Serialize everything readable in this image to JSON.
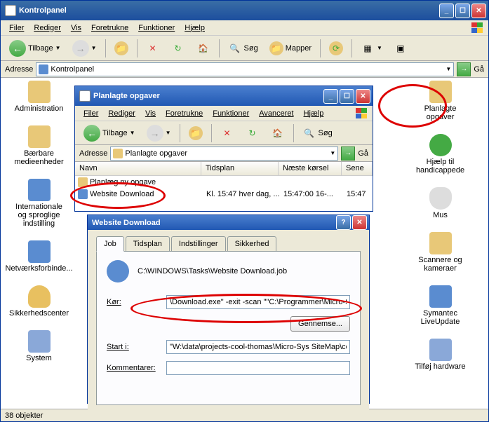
{
  "main": {
    "title": "Kontrolpanel",
    "menu": [
      "Filer",
      "Rediger",
      "Vis",
      "Foretrukne",
      "Funktioner",
      "Hjælp"
    ],
    "toolbar": {
      "back": "Tilbage",
      "search": "Søg",
      "folders": "Mapper"
    },
    "address": {
      "label": "Adresse",
      "value": "Kontrolpanel",
      "go": "Gå"
    },
    "status": "38 objekter",
    "leftIcons": [
      {
        "label": "Administration",
        "color": "#e8c878"
      },
      {
        "label": "Bærbare medieenheder",
        "color": "#e8c878"
      },
      {
        "label": "Internationale og sproglige indstilling",
        "color": "#5a8cd0"
      },
      {
        "label": "Netværksforbinde...",
        "color": "#5a8cd0"
      },
      {
        "label": "Sikkerhedscenter",
        "color": "#e8c060"
      },
      {
        "label": "System",
        "color": "#8aa8d8"
      }
    ],
    "rightIcons": [
      {
        "label": "Planlagte opgaver",
        "color": "#e8c878"
      },
      {
        "label": "Hjælp til handicappede",
        "color": "#4a4"
      },
      {
        "label": "Mus",
        "color": "#ddd"
      },
      {
        "label": "Scannere og kameraer",
        "color": "#e8c878"
      },
      {
        "label": "Symantec LiveUpdate",
        "color": "#5a8cd0"
      },
      {
        "label": "Tilføj hardware",
        "color": "#8aa8d8"
      }
    ]
  },
  "tasks": {
    "title": "Planlagte opgaver",
    "menu": [
      "Filer",
      "Rediger",
      "Vis",
      "Foretrukne",
      "Funktioner",
      "Avanceret",
      "Hjælp"
    ],
    "toolbar": {
      "back": "Tilbage",
      "search": "Søg"
    },
    "address": {
      "label": "Adresse",
      "value": "Planlagte opgaver",
      "go": "Gå"
    },
    "columns": [
      "Navn",
      "Tidsplan",
      "Næste kørsel",
      "Sene"
    ],
    "rows": [
      {
        "name": "Planlæg ny opgave",
        "sched": "",
        "next": "",
        "last": ""
      },
      {
        "name": "Website Download",
        "sched": "Kl. 15:47 hver dag, ...",
        "next": "15:47:00  16-...",
        "last": "15:47"
      }
    ]
  },
  "dlg": {
    "title": "Website Download",
    "tabs": [
      "Job",
      "Tidsplan",
      "Indstillinger",
      "Sikkerhed"
    ],
    "path": "C:\\WINDOWS\\Tasks\\Website Download.job",
    "run": {
      "label": "Kør:",
      "value": "\\Download.exe\" -exit -scan \"\"C:\\Programmer\\Micro-Sys S"
    },
    "browse": "Gennemse...",
    "startin": {
      "label": "Start i:",
      "value": "\"W:\\data\\projects-cool-thomas\\Micro-Sys SiteMap\\compi"
    },
    "comments": {
      "label": "Kommentarer:"
    }
  }
}
